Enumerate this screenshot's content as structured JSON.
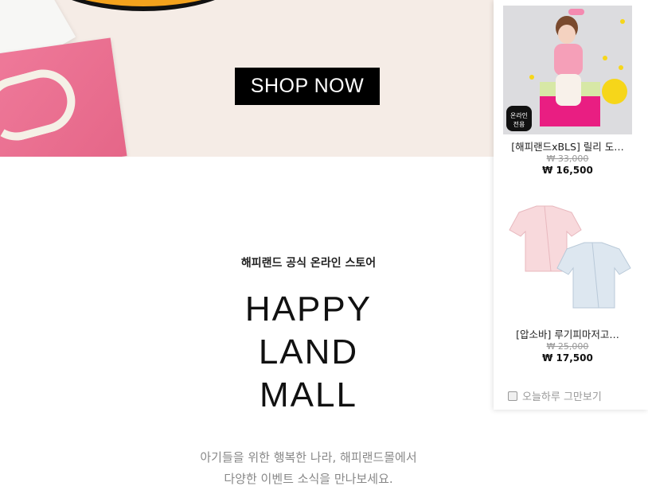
{
  "banner": {
    "button_label": "SHOP NOW"
  },
  "content": {
    "subtitle": "해피랜드 공식 온라인 스토어",
    "brand_lines": [
      "HAPPY",
      "LAND",
      "MALL"
    ],
    "desc_lines": [
      "아기들을 위한 행복한 나라, 해피랜드몰에서",
      "다양한 이벤트 소식을 만나보세요."
    ]
  },
  "panel": {
    "products": [
      {
        "name": "[해피랜드xBLS] 릴리 도…",
        "original_price": "₩ 33,000",
        "sale_price": "₩ 16,500",
        "badge": "온라인 전용"
      },
      {
        "name": "[압소바] 루기피마저고…",
        "original_price": "₩ 25,000",
        "sale_price": "₩ 17,500"
      }
    ],
    "dismiss_label": "오늘하루 그만보기"
  },
  "colors": {
    "banner_bg": "#f5ece6",
    "button_bg": "#000000",
    "accent_pink": "#f07c9c"
  }
}
